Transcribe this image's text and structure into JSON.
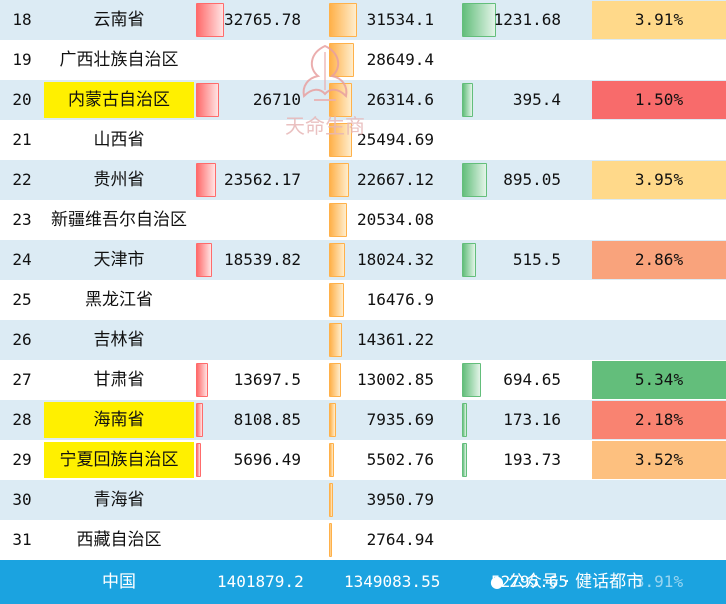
{
  "rows": [
    {
      "rank": "18",
      "name": "云南省",
      "hl": false,
      "v1": "32765.78",
      "v2": "31534.1",
      "v3": "1231.68",
      "pct": "3.91%",
      "pct_color": "#ffd98a",
      "alt": true
    },
    {
      "rank": "19",
      "name": "广西壮族自治区",
      "hl": false,
      "v1": "",
      "v2": "28649.4",
      "v3": "",
      "pct": "",
      "pct_color": "",
      "alt": false
    },
    {
      "rank": "20",
      "name": "内蒙古自治区",
      "hl": true,
      "v1": "26710",
      "v2": "26314.6",
      "v3": "395.4",
      "pct": "1.50%",
      "pct_color": "#f86b6b",
      "alt": true
    },
    {
      "rank": "21",
      "name": "山西省",
      "hl": false,
      "v1": "",
      "v2": "25494.69",
      "v3": "",
      "pct": "",
      "pct_color": "",
      "alt": false
    },
    {
      "rank": "22",
      "name": "贵州省",
      "hl": false,
      "v1": "23562.17",
      "v2": "22667.12",
      "v3": "895.05",
      "pct": "3.95%",
      "pct_color": "#ffd98a",
      "alt": true
    },
    {
      "rank": "23",
      "name": "新疆维吾尔自治区",
      "hl": false,
      "v1": "",
      "v2": "20534.08",
      "v3": "",
      "pct": "",
      "pct_color": "",
      "alt": false
    },
    {
      "rank": "24",
      "name": "天津市",
      "hl": false,
      "v1": "18539.82",
      "v2": "18024.32",
      "v3": "515.5",
      "pct": "2.86%",
      "pct_color": "#f9a37c",
      "alt": true
    },
    {
      "rank": "25",
      "name": "黑龙江省",
      "hl": false,
      "v1": "",
      "v2": "16476.9",
      "v3": "",
      "pct": "",
      "pct_color": "",
      "alt": false
    },
    {
      "rank": "26",
      "name": "吉林省",
      "hl": false,
      "v1": "",
      "v2": "14361.22",
      "v3": "",
      "pct": "",
      "pct_color": "",
      "alt": true
    },
    {
      "rank": "27",
      "name": "甘肃省",
      "hl": false,
      "v1": "13697.5",
      "v2": "13002.85",
      "v3": "694.65",
      "pct": "5.34%",
      "pct_color": "#63be7b",
      "alt": false
    },
    {
      "rank": "28",
      "name": "海南省",
      "hl": true,
      "v1": "8108.85",
      "v2": "7935.69",
      "v3": "173.16",
      "pct": "2.18%",
      "pct_color": "#f98371",
      "alt": true
    },
    {
      "rank": "29",
      "name": "宁夏回族自治区",
      "hl": true,
      "v1": "5696.49",
      "v2": "5502.76",
      "v3": "193.73",
      "pct": "3.52%",
      "pct_color": "#fdc07f",
      "alt": false
    },
    {
      "rank": "30",
      "name": "青海省",
      "hl": false,
      "v1": "",
      "v2": "3950.79",
      "v3": "",
      "pct": "",
      "pct_color": "",
      "alt": true
    },
    {
      "rank": "31",
      "name": "西藏自治区",
      "hl": false,
      "v1": "",
      "v2": "2764.94",
      "v3": "",
      "pct": "",
      "pct_color": "",
      "alt": false
    }
  ],
  "total": {
    "name": "中国",
    "v1": "1401879.2",
    "v2": "1349083.55",
    "v3": "52795.65",
    "pct": "3.91%"
  },
  "watermark": {
    "text": "天命生商"
  },
  "footer": {
    "text": "公众号 · 健话都市"
  }
}
